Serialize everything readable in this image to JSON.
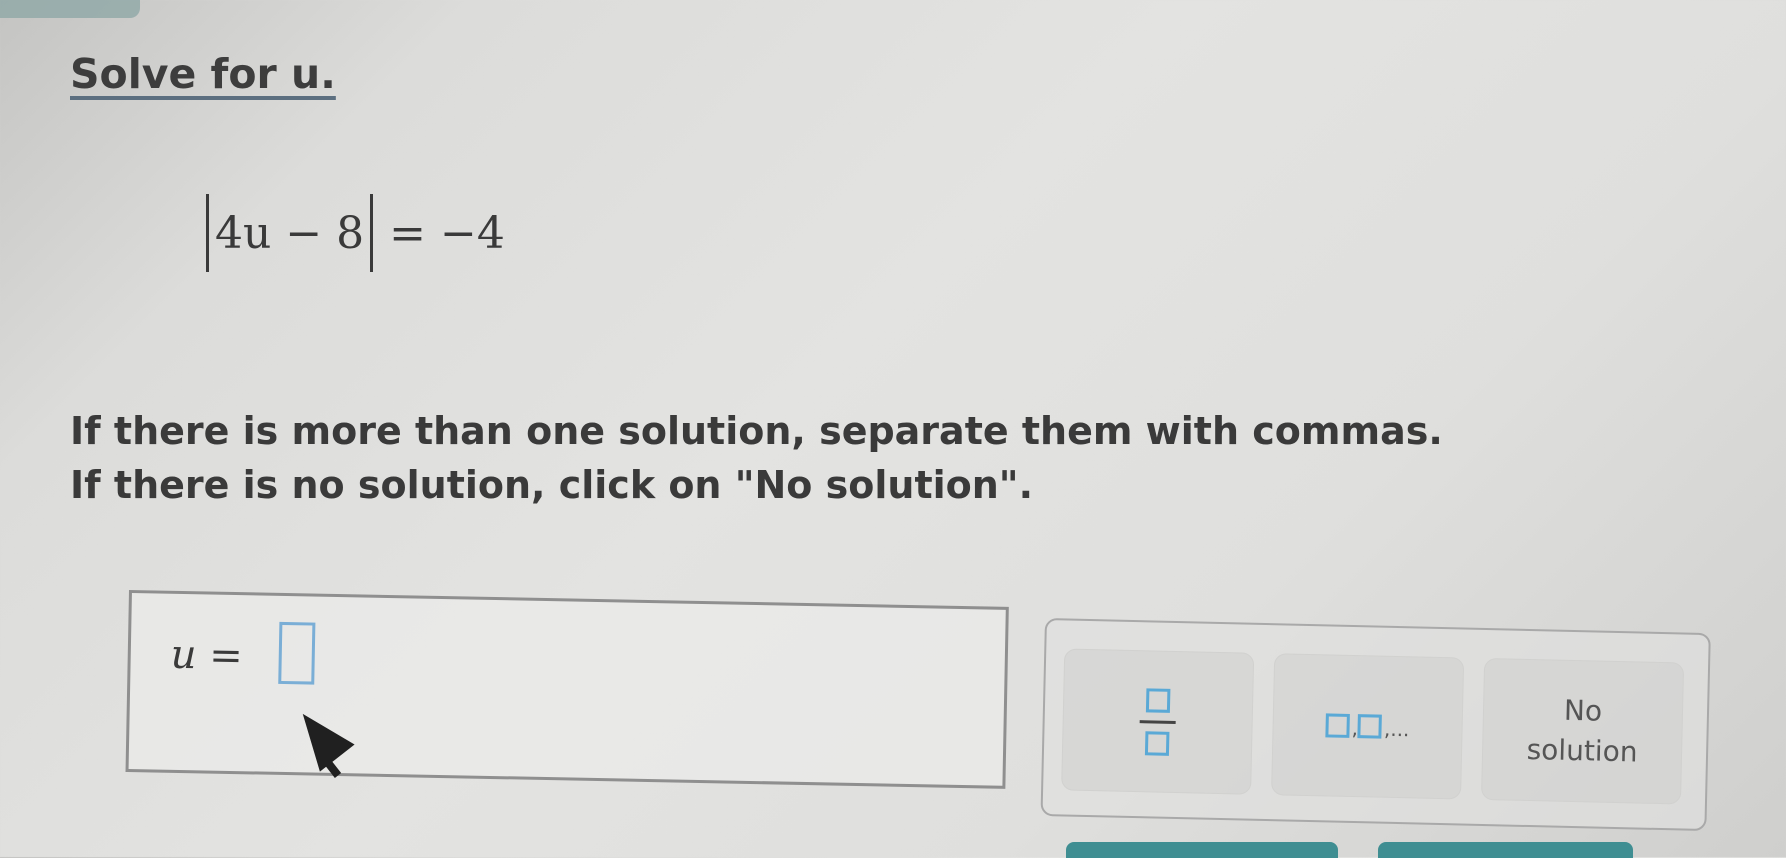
{
  "prompt": {
    "solve_for": "Solve for u."
  },
  "equation": {
    "inside_abs": "4u − 8",
    "rhs": "= −4"
  },
  "instructions": {
    "line1": "If there is more than one solution, separate them with commas.",
    "line2": "If there is no solution, click on \"No solution\"."
  },
  "answer": {
    "label": "u =",
    "value": ""
  },
  "keypad": {
    "fraction_key_label": "",
    "list_key_label": "",
    "no_solution_line1": "No",
    "no_solution_line2": "solution",
    "icons": {
      "fraction": "fraction-template-icon",
      "list": "list-template-icon"
    }
  },
  "colors": {
    "accent_blue": "#5aa9d6",
    "teal_bar": "#3f8e92",
    "text_dark": "#3a3a3a"
  }
}
